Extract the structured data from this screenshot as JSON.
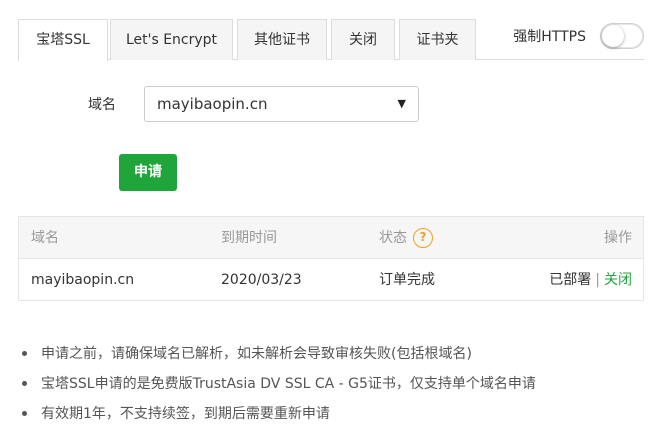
{
  "tabs": [
    {
      "label": "宝塔SSL",
      "active": true
    },
    {
      "label": "Let's Encrypt",
      "active": false
    },
    {
      "label": "其他证书",
      "active": false
    },
    {
      "label": "关闭",
      "active": false
    },
    {
      "label": "证书夹",
      "active": false
    }
  ],
  "force_https": {
    "label": "强制HTTPS",
    "enabled": false
  },
  "domain": {
    "label": "域名",
    "selected": "mayibaopin.cn",
    "caret": "▼"
  },
  "apply_button": "申请",
  "table": {
    "headers": {
      "domain": "域名",
      "expiry": "到期时间",
      "status": "状态",
      "actions": "操作"
    },
    "status_help_icon": "?",
    "rows": [
      {
        "domain": "mayibaopin.cn",
        "expiry": "2020/03/23",
        "status": "订单完成",
        "deployed": "已部署",
        "separator": "|",
        "close": "关闭"
      }
    ]
  },
  "notes": [
    "申请之前，请确保域名已解析，如未解析会导致审核失败(包括根域名)",
    "宝塔SSL申请的是免费版TrustAsia DV SSL CA - G5证书，仅支持单个域名申请",
    "有效期1年，不支持续签，到期后需要重新申请"
  ],
  "colors": {
    "accent": "#20a53a",
    "help_icon": "#f0a020"
  }
}
